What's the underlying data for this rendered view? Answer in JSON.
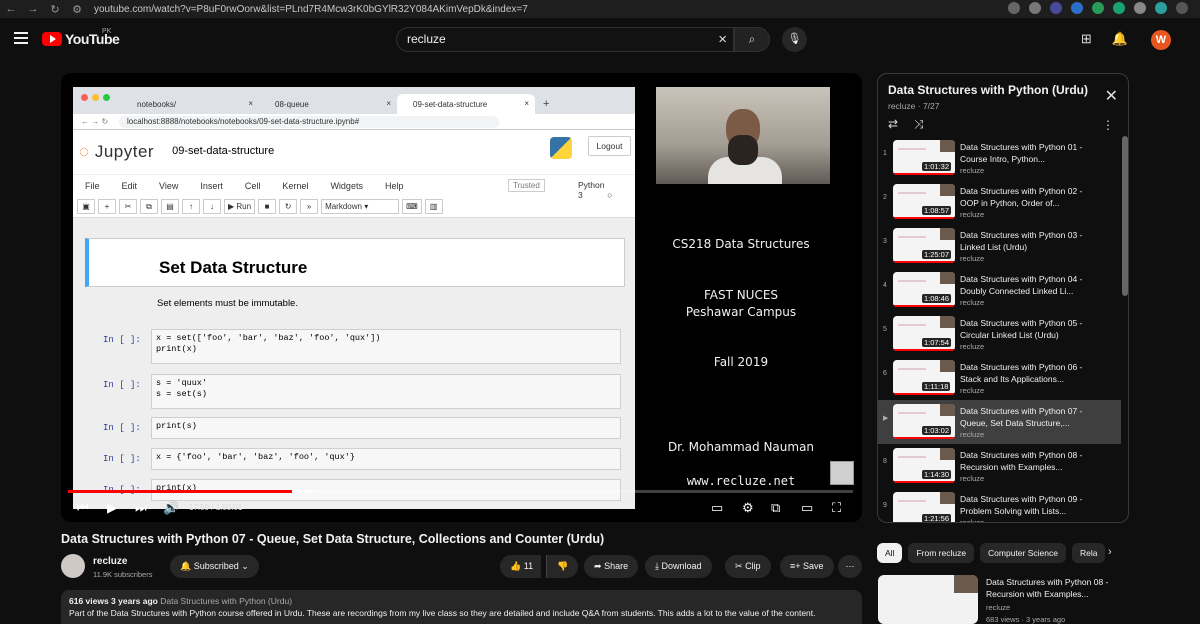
{
  "browser": {
    "url": "youtube.com/watch?v=P8uF0rwOorw&list=PLnd7R4Mcw3rK0bGYlR32Y084AKimVepDk&index=7"
  },
  "header": {
    "logo": "YouTube",
    "region": "PK",
    "search_value": "recluze",
    "avatar_letter": "W"
  },
  "slide": {
    "tabs": [
      "notebooks/",
      "08-queue",
      "09-set-data-structure"
    ],
    "address": "localhost:8888/notebooks/notebooks/09-set-data-structure.ipynb#",
    "jupyter_brand_a": "Jupyter",
    "notebook_name": "09-set-data-structure",
    "logout": "Logout",
    "menu": [
      "File",
      "Edit",
      "View",
      "Insert",
      "Cell",
      "Kernel",
      "Widgets",
      "Help"
    ],
    "trusted": "Trusted",
    "kernel": "Python 3",
    "run": "Run",
    "cell_type": "Markdown",
    "heading": "Set Data Structure",
    "markdown_text": "Set elements must be immutable.",
    "prompt": "In [ ]:",
    "cells": [
      "x = set(['foo', 'bar', 'baz', 'foo', 'qux'])\nprint(x)",
      "s = 'quux'\ns = set(s)",
      "print(s)",
      "x = {'foo', 'bar', 'baz', 'foo', 'qux'}",
      "print(x)"
    ]
  },
  "lecture": {
    "course": "CS218 Data Structures",
    "inst1": "FAST NUCES",
    "inst2": "Peshawar Campus",
    "term": "Fall 2019",
    "instructor": "Dr. Mohammad Nauman",
    "site": "www.recluze.net"
  },
  "player": {
    "time": "17:59 / 1:03:01",
    "progress": 0.285
  },
  "playlist": {
    "title": "Data Structures with Python (Urdu)",
    "sub": "recluze · 7/27",
    "items": [
      {
        "n": "1",
        "t": "Data Structures with Python 01 - Course Intro, Python...",
        "d": "1:01:32",
        "ch": "recluze"
      },
      {
        "n": "2",
        "t": "Data Structures with Python 02 - OOP in Python, Order of...",
        "d": "1:08:57",
        "ch": "recluze"
      },
      {
        "n": "3",
        "t": "Data Structures with Python 03 - Linked List (Urdu)",
        "d": "1:25:07",
        "ch": "recluze"
      },
      {
        "n": "4",
        "t": "Data Structures with Python 04 - Doubly Connected Linked Li...",
        "d": "1:08:46",
        "ch": "recluze"
      },
      {
        "n": "5",
        "t": "Data Structures with Python 05 - Circular Linked List (Urdu)",
        "d": "1:07:54",
        "ch": "recluze"
      },
      {
        "n": "6",
        "t": "Data Structures with Python 06 - Stack and Its Applications...",
        "d": "1:11:18",
        "ch": "recluze"
      },
      {
        "n": "▶",
        "t": "Data Structures with Python 07 - Queue, Set Data Structure,...",
        "d": "1:03:02",
        "ch": "recluze"
      },
      {
        "n": "8",
        "t": "Data Structures with Python 08 - Recursion with Examples...",
        "d": "1:14:30",
        "ch": "recluze"
      },
      {
        "n": "9",
        "t": "Data Structures with Python 09 - Problem Solving with Lists...",
        "d": "1:21:56",
        "ch": "recluze"
      }
    ]
  },
  "video": {
    "title": "Data Structures with Python 07 - Queue, Set Data Structure, Collections and Counter (Urdu)",
    "channel": "recluze",
    "subscribers": "11.9K subscribers",
    "subscribed": "Subscribed",
    "likes": "11",
    "share": "Share",
    "download": "Download",
    "clip": "Clip",
    "save": "Save",
    "views": "616 views  3 years ago",
    "playlist_tag": "Data Structures with Python (Urdu)",
    "description": "Part of the Data Structures with Python course offered in Urdu. These are recordings from my live class so they are detailed and include Q&A from students. This adds a lot to the value of the content."
  },
  "chips": [
    "All",
    "From recluze",
    "Computer Science",
    "Rela"
  ],
  "recommended": {
    "title": "Data Structures with Python 08 - Recursion with Examples...",
    "channel": "recluze",
    "stats": "683 views · 3 years ago"
  }
}
